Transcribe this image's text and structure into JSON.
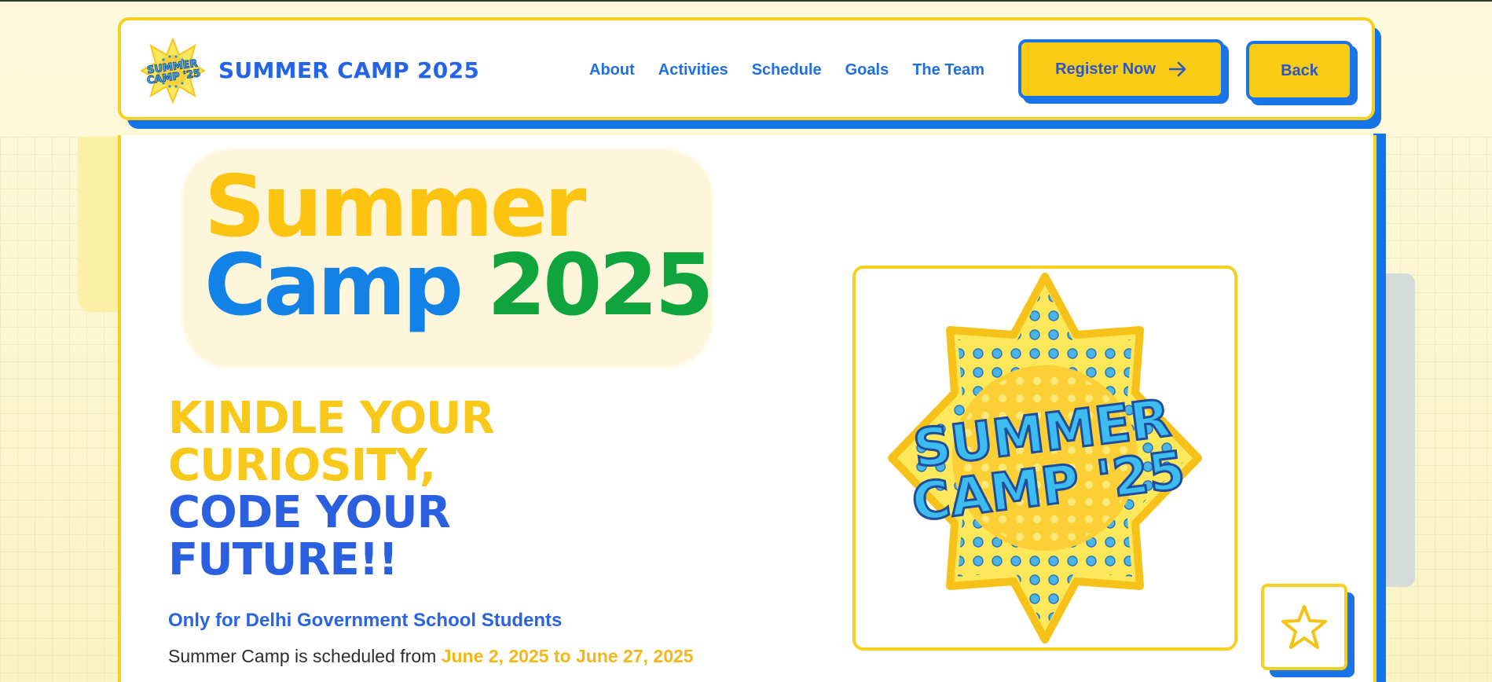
{
  "header": {
    "brand": "SUMMER CAMP 2025",
    "logo_text": [
      "SUMMER",
      "CAMP '25"
    ],
    "nav": [
      "About",
      "Activities",
      "Schedule",
      "Goals",
      "The Team"
    ],
    "register_label": "Register Now",
    "back_label": "Back"
  },
  "hero": {
    "title_line1": "Summer",
    "title_line2a": "Camp",
    "title_line2b": "2025",
    "tagline": [
      "KINDLE YOUR",
      "CURIOSITY,",
      "CODE YOUR",
      "FUTURE!!"
    ],
    "eligibility": "Only for Delhi Government School Students",
    "schedule_prefix": "Summer Camp is scheduled from",
    "schedule_dates": "June 2, 2025 to June 27, 2025",
    "badge_text": [
      "SUMMER",
      "CAMP '25"
    ]
  },
  "colors": {
    "yellow": "#f8cb15",
    "blue": "#1a73e8",
    "green": "#0fa53c",
    "link_blue": "#1e6fe3"
  },
  "icons": [
    "arrow-right-icon",
    "star-icon",
    "summer-camp-logo"
  ]
}
